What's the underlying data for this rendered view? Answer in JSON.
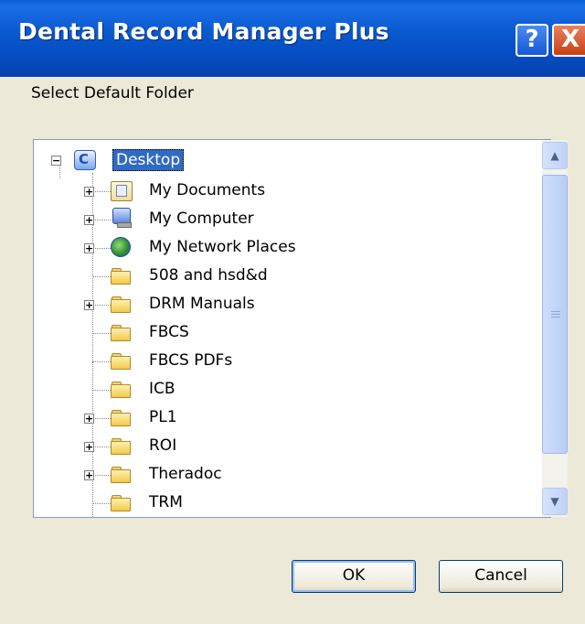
{
  "window": {
    "title": "Dental Record Manager Plus",
    "help_button": "?",
    "close_button": "X"
  },
  "dialog": {
    "prompt": "Select Default Folder"
  },
  "tree": {
    "root": {
      "label": "Desktop",
      "icon": "desktop-icon",
      "expanded": true,
      "selected": true
    },
    "items": [
      {
        "label": "My Documents",
        "icon": "my-documents-icon",
        "expandable": true
      },
      {
        "label": "My Computer",
        "icon": "my-computer-icon",
        "expandable": true
      },
      {
        "label": "My Network Places",
        "icon": "network-places-icon",
        "expandable": true
      },
      {
        "label": "508 and hsd&d",
        "icon": "folder-icon",
        "expandable": false
      },
      {
        "label": "DRM Manuals",
        "icon": "folder-icon",
        "expandable": true
      },
      {
        "label": "FBCS",
        "icon": "folder-icon",
        "expandable": false
      },
      {
        "label": "FBCS PDFs",
        "icon": "folder-icon",
        "expandable": false
      },
      {
        "label": "ICB",
        "icon": "folder-icon",
        "expandable": false
      },
      {
        "label": "PL1",
        "icon": "folder-icon",
        "expandable": true
      },
      {
        "label": "ROI",
        "icon": "folder-icon",
        "expandable": true
      },
      {
        "label": "Theradoc",
        "icon": "folder-icon",
        "expandable": true
      },
      {
        "label": "TRM",
        "icon": "folder-icon",
        "expandable": false
      }
    ]
  },
  "buttons": {
    "ok": "OK",
    "cancel": "Cancel"
  },
  "colors": {
    "titlebar": "#0a5ad0",
    "selection": "#316ac5",
    "dialog_bg": "#ece9d8"
  }
}
